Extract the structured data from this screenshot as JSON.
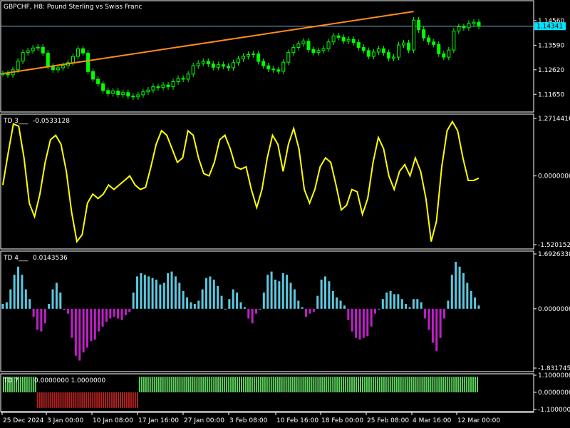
{
  "colors": {
    "background": "#000000",
    "frame": "#ffffff",
    "candle": "#00ff00",
    "trendline": "#ff8c1a",
    "price_line": "#7fb2d0",
    "price_box": "#00e5ff",
    "td3_line": "#ffff00",
    "td4_up": "#5bc8e0",
    "td4_down": "#c01fc8",
    "td7_up": "#5fd35f",
    "td7_down": "#b22222"
  },
  "chart_data": [
    {
      "type": "candlestick",
      "title": "GBPCHF, H8:  Pound Sterling vs Swiss Franc",
      "yticks": [
        "1.14560",
        "1.13590",
        "1.12620",
        "1.11650"
      ],
      "ylim": [
        1.1115,
        1.1515
      ],
      "current_price": "1.14341",
      "trendline": {
        "from": [
          0,
          1.1247
        ],
        "to": [
          82,
          1.1492
        ]
      },
      "close": [
        1.1247,
        1.1242,
        1.1262,
        1.1296,
        1.133,
        1.1337,
        1.1348,
        1.1351,
        1.1328,
        1.1276,
        1.1262,
        1.127,
        1.1278,
        1.129,
        1.1315,
        1.1345,
        1.1328,
        1.1255,
        1.1225,
        1.1207,
        1.118,
        1.1168,
        1.1178,
        1.1164,
        1.1172,
        1.1158,
        1.1155,
        1.1163,
        1.1175,
        1.1182,
        1.1195,
        1.1192,
        1.1202,
        1.1195,
        1.1215,
        1.1228,
        1.1225,
        1.1245,
        1.1278,
        1.1288,
        1.1295,
        1.1285,
        1.1272,
        1.1282,
        1.1276,
        1.127,
        1.129,
        1.1305,
        1.1315,
        1.1322,
        1.1325,
        1.1295,
        1.1278,
        1.1265,
        1.1262,
        1.1256,
        1.1292,
        1.133,
        1.135,
        1.1365,
        1.1375,
        1.1342,
        1.133,
        1.1338,
        1.1345,
        1.1372,
        1.1396,
        1.139,
        1.1375,
        1.1382,
        1.137,
        1.135,
        1.1338,
        1.1315,
        1.1332,
        1.1345,
        1.133,
        1.1308,
        1.1312,
        1.136,
        1.1368,
        1.134,
        1.1458,
        1.142,
        1.1388,
        1.1372,
        1.1362,
        1.1325,
        1.1312,
        1.134,
        1.1415,
        1.1432,
        1.1428,
        1.1445,
        1.145,
        1.1434
      ]
    },
    {
      "type": "line",
      "name": "TD 3___",
      "value_label": "-0.0533128",
      "yticks": [
        "1.2714416",
        "0.0000000",
        "-1.5201527"
      ],
      "ylim": [
        -1.5201527,
        1.2714416
      ],
      "values": [
        -0.2,
        0.5,
        1.15,
        1.1,
        0.4,
        -0.6,
        -0.9,
        -0.4,
        0.3,
        0.8,
        0.9,
        0.7,
        0.1,
        -0.8,
        -1.45,
        -1.3,
        -0.6,
        -0.4,
        -0.5,
        -0.4,
        -0.2,
        -0.3,
        -0.2,
        -0.1,
        0.0,
        -0.2,
        -0.3,
        -0.25,
        0.2,
        0.7,
        1.0,
        0.9,
        0.6,
        0.3,
        0.4,
        1.0,
        0.9,
        0.4,
        0.05,
        0.0,
        0.3,
        0.8,
        0.9,
        0.6,
        0.2,
        0.15,
        0.2,
        -0.3,
        -0.7,
        -0.3,
        0.4,
        0.9,
        0.7,
        0.1,
        0.7,
        1.05,
        0.6,
        -0.3,
        -0.6,
        -0.3,
        0.2,
        0.4,
        0.3,
        -0.2,
        -0.75,
        -0.65,
        -0.3,
        -0.35,
        -0.85,
        -0.5,
        0.3,
        0.85,
        0.6,
        0.0,
        -0.3,
        0.1,
        0.25,
        0.0,
        0.4,
        0.1,
        -0.5,
        -1.45,
        -1.0,
        0.2,
        1.0,
        1.2,
        1.0,
        0.4,
        -0.1,
        -0.1,
        -0.05
      ]
    },
    {
      "type": "bar",
      "name": "TD 4___",
      "value_label": "0.0143536",
      "yticks": [
        "1.6926338",
        "0.0000000",
        "-1.8317459"
      ],
      "ylim": [
        -1.8317459,
        1.6926338
      ],
      "values": [
        0.15,
        0.2,
        0.6,
        1.05,
        1.3,
        1.05,
        0.6,
        0.3,
        -0.25,
        -0.65,
        -0.7,
        -0.45,
        0.15,
        0.6,
        0.8,
        0.5,
        0.0,
        -0.15,
        -0.9,
        -1.45,
        -1.6,
        -1.35,
        -1.2,
        -1.0,
        -0.95,
        -0.7,
        -0.55,
        -0.4,
        -0.3,
        -0.25,
        -0.3,
        -0.35,
        -0.2,
        -0.1,
        0.5,
        1.0,
        1.1,
        1.05,
        1.0,
        0.95,
        0.9,
        0.75,
        0.8,
        1.1,
        1.15,
        1.0,
        0.8,
        0.55,
        0.35,
        0.2,
        0.15,
        0.25,
        0.6,
        0.95,
        1.0,
        0.9,
        0.7,
        0.4,
        0.0,
        0.3,
        0.6,
        0.5,
        0.2,
        0.05,
        -0.3,
        -0.45,
        -0.15,
        0.0,
        0.5,
        1.05,
        1.15,
        0.9,
        0.85,
        1.1,
        1.05,
        0.8,
        0.6,
        0.25,
        0.05,
        -0.25,
        -0.15,
        -0.1,
        0.4,
        0.9,
        1.0,
        0.85,
        0.55,
        0.35,
        0.25,
        0.1,
        -0.35,
        -0.7,
        -0.9,
        -0.95,
        -0.9,
        -0.85,
        -0.55,
        -0.15,
        0.0,
        0.3,
        0.5,
        0.55,
        0.45,
        0.45,
        0.3,
        0.15,
        0.05,
        0.3,
        0.3,
        0.2,
        -0.3,
        -0.65,
        -1.05,
        -1.3,
        -0.9,
        -0.3,
        0.25,
        1.05,
        1.45,
        1.3,
        1.1,
        0.8,
        0.55,
        0.35,
        0.1
      ]
    },
    {
      "type": "bar",
      "name": "TD 7",
      "value_label": "0.0000000 1.0000000",
      "yticks": [
        "1.1000000",
        "0.0000000",
        "-1.1000000"
      ],
      "ylim": [
        -1.1,
        1.1
      ],
      "segments": [
        {
          "from": 0,
          "to": 16,
          "value": 1
        },
        {
          "from": 16,
          "to": 64,
          "value": -1
        },
        {
          "from": 64,
          "to": 224,
          "value": 1
        }
      ],
      "total_bars": 224
    }
  ],
  "x_axis": {
    "labels": [
      "25 Dec 2024",
      "3 Jan 00:00",
      "10 Jan 08:00",
      "17 Jan 16:00",
      "27 Jan 00:00",
      "3 Feb 08:00",
      "10 Feb 16:00",
      "18 Feb 00:00",
      "25 Feb 08:00",
      "4 Mar 16:00",
      "12 Mar 00:00"
    ]
  }
}
